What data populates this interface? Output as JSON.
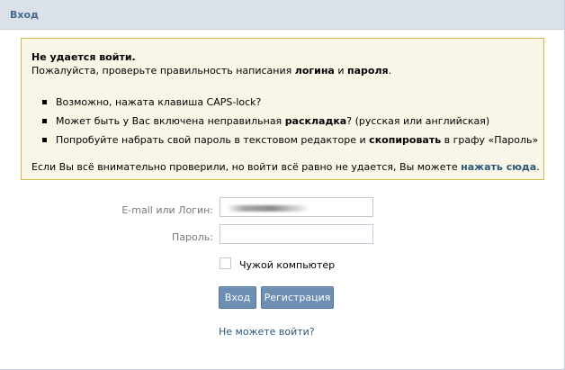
{
  "header": {
    "title": "Вход"
  },
  "error_box": {
    "title": "Не удается войти.",
    "intro_pre": "Пожалуйста, проверьте правильность написания ",
    "intro_bold1": "логина",
    "intro_mid": " и ",
    "intro_bold2": "пароля",
    "intro_post": ".",
    "items": [
      {
        "text": "Возможно, нажата клавиша CAPS-lock?"
      },
      {
        "pre": "Может быть у Вас включена неправильная ",
        "bold": "раскладка",
        "post": "? (русская или английская)"
      },
      {
        "pre": "Попробуйте набрать свой пароль в текстовом редакторе и ",
        "bold": "скопировать",
        "post": " в графу «Пароль»"
      }
    ],
    "footer_pre": "Если Вы всё внимательно проверили, но войти всё равно не удается, Вы можете ",
    "footer_link": "нажать сюда",
    "footer_post": "."
  },
  "form": {
    "login_label": "E-mail или Логин:",
    "password_label": "Пароль:",
    "foreign_computer_label": "Чужой компьютер",
    "login_button": "Вход",
    "register_button": "Регистрация",
    "cant_login_link": "Не можете войти?"
  },
  "colors": {
    "header_bg": "#dae1e8",
    "header_text": "#45688e",
    "box_bg": "#f9f6e7",
    "box_border": "#d4bc4c",
    "button_bg": "#6d8fb3",
    "link": "#2b587a"
  }
}
